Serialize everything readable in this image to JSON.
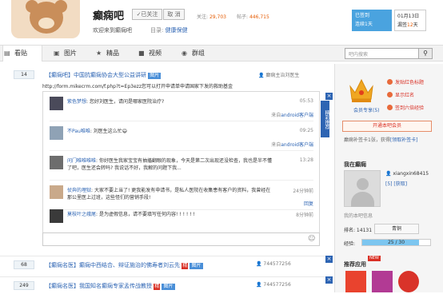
{
  "header": {
    "forum_name": "癫痫吧",
    "follow_label": "✓已关注",
    "cancel_label": "取 消",
    "stats": {
      "followers_label": "关注:",
      "followers_value": "29,703",
      "posts_label": "帖子:",
      "posts_value": "446,715"
    },
    "welcome": "欢迎来到癫痫吧",
    "category_label": "目录:",
    "category_value": "健康保健",
    "signin": {
      "line1": "已签到",
      "line2": "连续1天"
    },
    "signin_date": {
      "line1": "01月13日",
      "line2_prefix": "漏签",
      "line2_value": "12",
      "line2_suffix": "天"
    }
  },
  "nav": {
    "tabs": [
      {
        "label": "看贴",
        "icon": "document-icon"
      },
      {
        "label": "图片",
        "icon": "image-icon"
      },
      {
        "label": "精品",
        "icon": "star-icon"
      },
      {
        "label": "视频",
        "icon": "video-icon"
      },
      {
        "label": "群组",
        "icon": "group-icon"
      }
    ],
    "search_placeholder": "吧内搜索"
  },
  "thread": {
    "reply_count": "14",
    "title": "【癫痫吧】中国抗癫痫协会大型公益讲研",
    "tag": "图片",
    "author": "癫痫主治刘医生",
    "url_line": "http://form.mikecrm.com/f.php?t=Ep3ezz您可以打开申请单申请国家下发的救助基金",
    "side_label": "精彩推荐",
    "comments": [
      {
        "user": "紫色梦想",
        "text": ": 您好刘医生，请问是哪家医院治疗?",
        "time": "05:53",
        "from_prefix": "来自",
        "from": "android客户端"
      },
      {
        "user": "不Pau唯唯",
        "text": ": 刘医生这么忙😄",
        "time": "09:25",
        "from_prefix": "来自",
        "from": "android客户端"
      },
      {
        "user": "问门唯唯唯唯",
        "text": ": 你好医生我家宝宝有抽搐翻眼的现象，今天是第二次出现还没检查，我也是半不懂了吧，医生还会转吗? 我说话不好，我解的问题下我...",
        "time": "13:28",
        "from_prefix": "",
        "from": ""
      },
      {
        "user": "仗奔的埋狱",
        "text": ": 大家不要上当了!  更我能发有申请书，是私人医院在收集患有客户的资料，我曾经在那公里医上过班，这些怪们的营销手段!",
        "time": "24分钟前",
        "from_prefix": "",
        "from": "回复"
      },
      {
        "user": "莫枝叶之峨尾",
        "text": ": 是为虚假信息，请不要填写任何内容!  !  !  !  !  !",
        "time": "8分钟前",
        "from_prefix": "",
        "from": ""
      }
    ]
  },
  "threads": [
    {
      "reply_count": "68",
      "title": "【癫痫名医】癫痫中西结合、辩证施治的佛寿者刘云先",
      "badges": [
        "精",
        "图片"
      ],
      "author": "744577256"
    },
    {
      "reply_count": "249",
      "title": "【癫痫名医】我国知名癫痫专家孟传战教授",
      "badges": [
        "精",
        "图片"
      ],
      "author": "744577256"
    }
  ],
  "sidebar": {
    "crown_label": "会员专享(5)",
    "perks": [
      "发贴红色标题",
      "显示红名",
      "签到六倍经验"
    ],
    "vip_button": "开通本吧会员",
    "ticket_prefix": "癫痫补签卡1张，获得",
    "ticket_link": "[领取补签卡]",
    "user_section": "我在癫痫",
    "username": "xiangxin68415",
    "level_label": "[5] [获取]",
    "info_link": "我的本吧信息",
    "rank_label": "排名: 14131",
    "rank_button": "青铜",
    "exp_label": "经验:",
    "exp_text": "25 / 30",
    "exp_fraction": 0.83,
    "apps_title": "推荐应用",
    "new_badge": "NEW"
  }
}
